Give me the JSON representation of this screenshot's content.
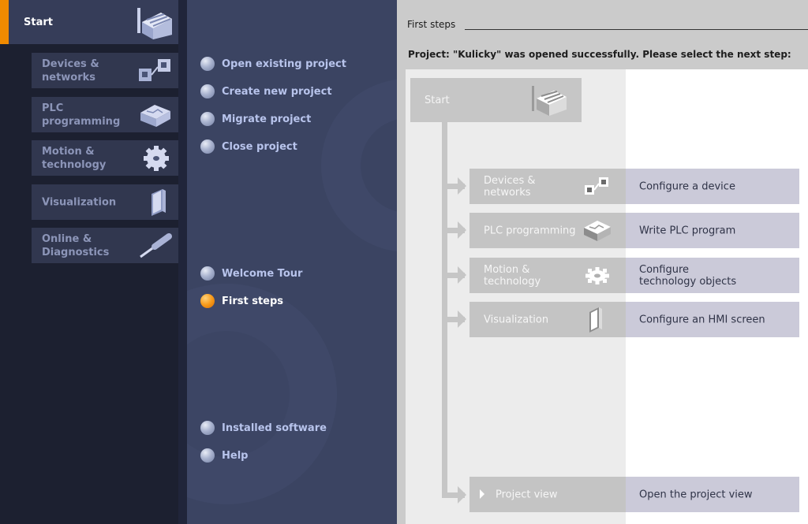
{
  "portal_nav": {
    "start": {
      "label": "Start",
      "icon": "factory-stairs-icon",
      "accent_color": "#f08a00"
    },
    "items": [
      {
        "label": "Devices &\nnetworks",
        "icon": "devices-networks-icon"
      },
      {
        "label": "PLC\nprogramming",
        "icon": "plc-programming-icon"
      },
      {
        "label": "Motion &\ntechnology",
        "icon": "gear-icon"
      },
      {
        "label": "Visualization",
        "icon": "hmi-screen-icon"
      },
      {
        "label": "Online &\nDiagnostics",
        "icon": "screwdriver-icon"
      }
    ]
  },
  "actions": {
    "project_actions": [
      {
        "label": "Open existing project"
      },
      {
        "label": "Create new project"
      },
      {
        "label": "Migrate project"
      },
      {
        "label": "Close project"
      }
    ],
    "info_actions": [
      {
        "label": "Welcome Tour",
        "active": false
      },
      {
        "label": "First steps",
        "active": true
      }
    ],
    "support_actions": [
      {
        "label": "Installed software"
      },
      {
        "label": "Help"
      }
    ]
  },
  "content": {
    "section_title": "First steps",
    "status_message": "Project: \"Kulicky\" was opened successfully. Please select the next step:",
    "flow_start": {
      "label": "Start",
      "icon": "factory-stairs-icon"
    },
    "steps": [
      {
        "name": "Devices &\nnetworks",
        "desc": "Configure a device",
        "icon": "devices-networks-icon"
      },
      {
        "name": "PLC programming",
        "desc": "Write PLC program",
        "icon": "plc-programming-icon"
      },
      {
        "name": "Motion &\ntechnology",
        "desc": "Configure\ntechnology objects",
        "icon": "gear-icon"
      },
      {
        "name": "Visualization",
        "desc": "Configure an HMI screen",
        "icon": "hmi-screen-icon"
      }
    ],
    "project_view": {
      "name": "Project view",
      "desc": "Open the project view",
      "icon": "play-triangle-icon"
    }
  }
}
